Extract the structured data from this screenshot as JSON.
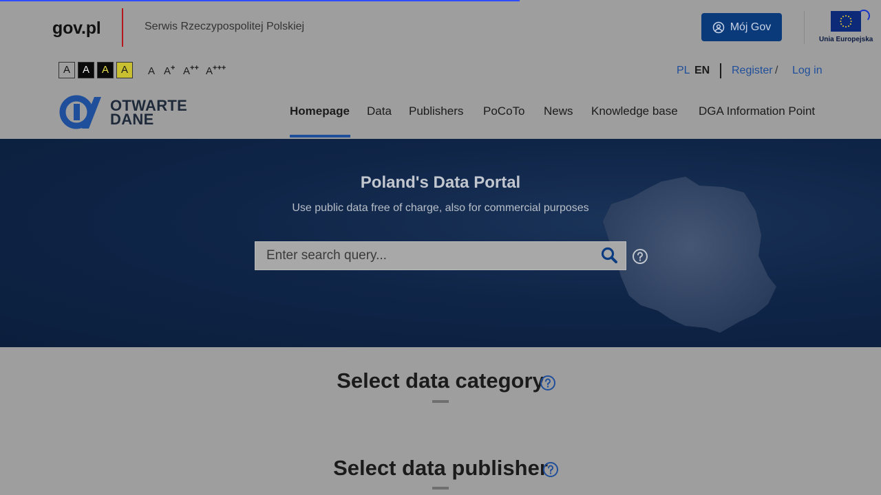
{
  "gov": {
    "logo": "gov.pl",
    "subtitle": "Serwis Rzeczypospolitej Polskiej",
    "moj_gov_label": "Mój Gov",
    "eu_label": "Unia Europejska"
  },
  "accessibility": {
    "contrast_options": [
      "A",
      "A",
      "A",
      "A"
    ],
    "font_sizes": [
      {
        "base": "A",
        "sup": ""
      },
      {
        "base": "A",
        "sup": "+"
      },
      {
        "base": "A",
        "sup": "++"
      },
      {
        "base": "A",
        "sup": "+++"
      }
    ]
  },
  "lang": {
    "pl": "PL",
    "en": "EN"
  },
  "auth": {
    "register": "Register",
    "separator": "/",
    "login": "Log in"
  },
  "brand": {
    "line1": "OTWARTE",
    "line2": "DANE"
  },
  "nav": {
    "items": [
      "Homepage",
      "Data",
      "Publishers",
      "PoCoTo",
      "News",
      "Knowledge base",
      "DGA Information Point"
    ],
    "active": "Homepage"
  },
  "hero": {
    "title": "Poland's Data Portal",
    "subtitle": "Use public data free of charge, also for commercial purposes",
    "search_placeholder": "Enter search query..."
  },
  "sections": {
    "category_title": "Select data category",
    "publisher_title": "Select data publisher"
  },
  "colors": {
    "overlay_gray": "#9e9e9e",
    "brand_blue": "#1f4e9a",
    "moj_gov_bg": "#0a3a7a",
    "hero_bg": "#0f2548",
    "gov_red": "#b5171f"
  }
}
